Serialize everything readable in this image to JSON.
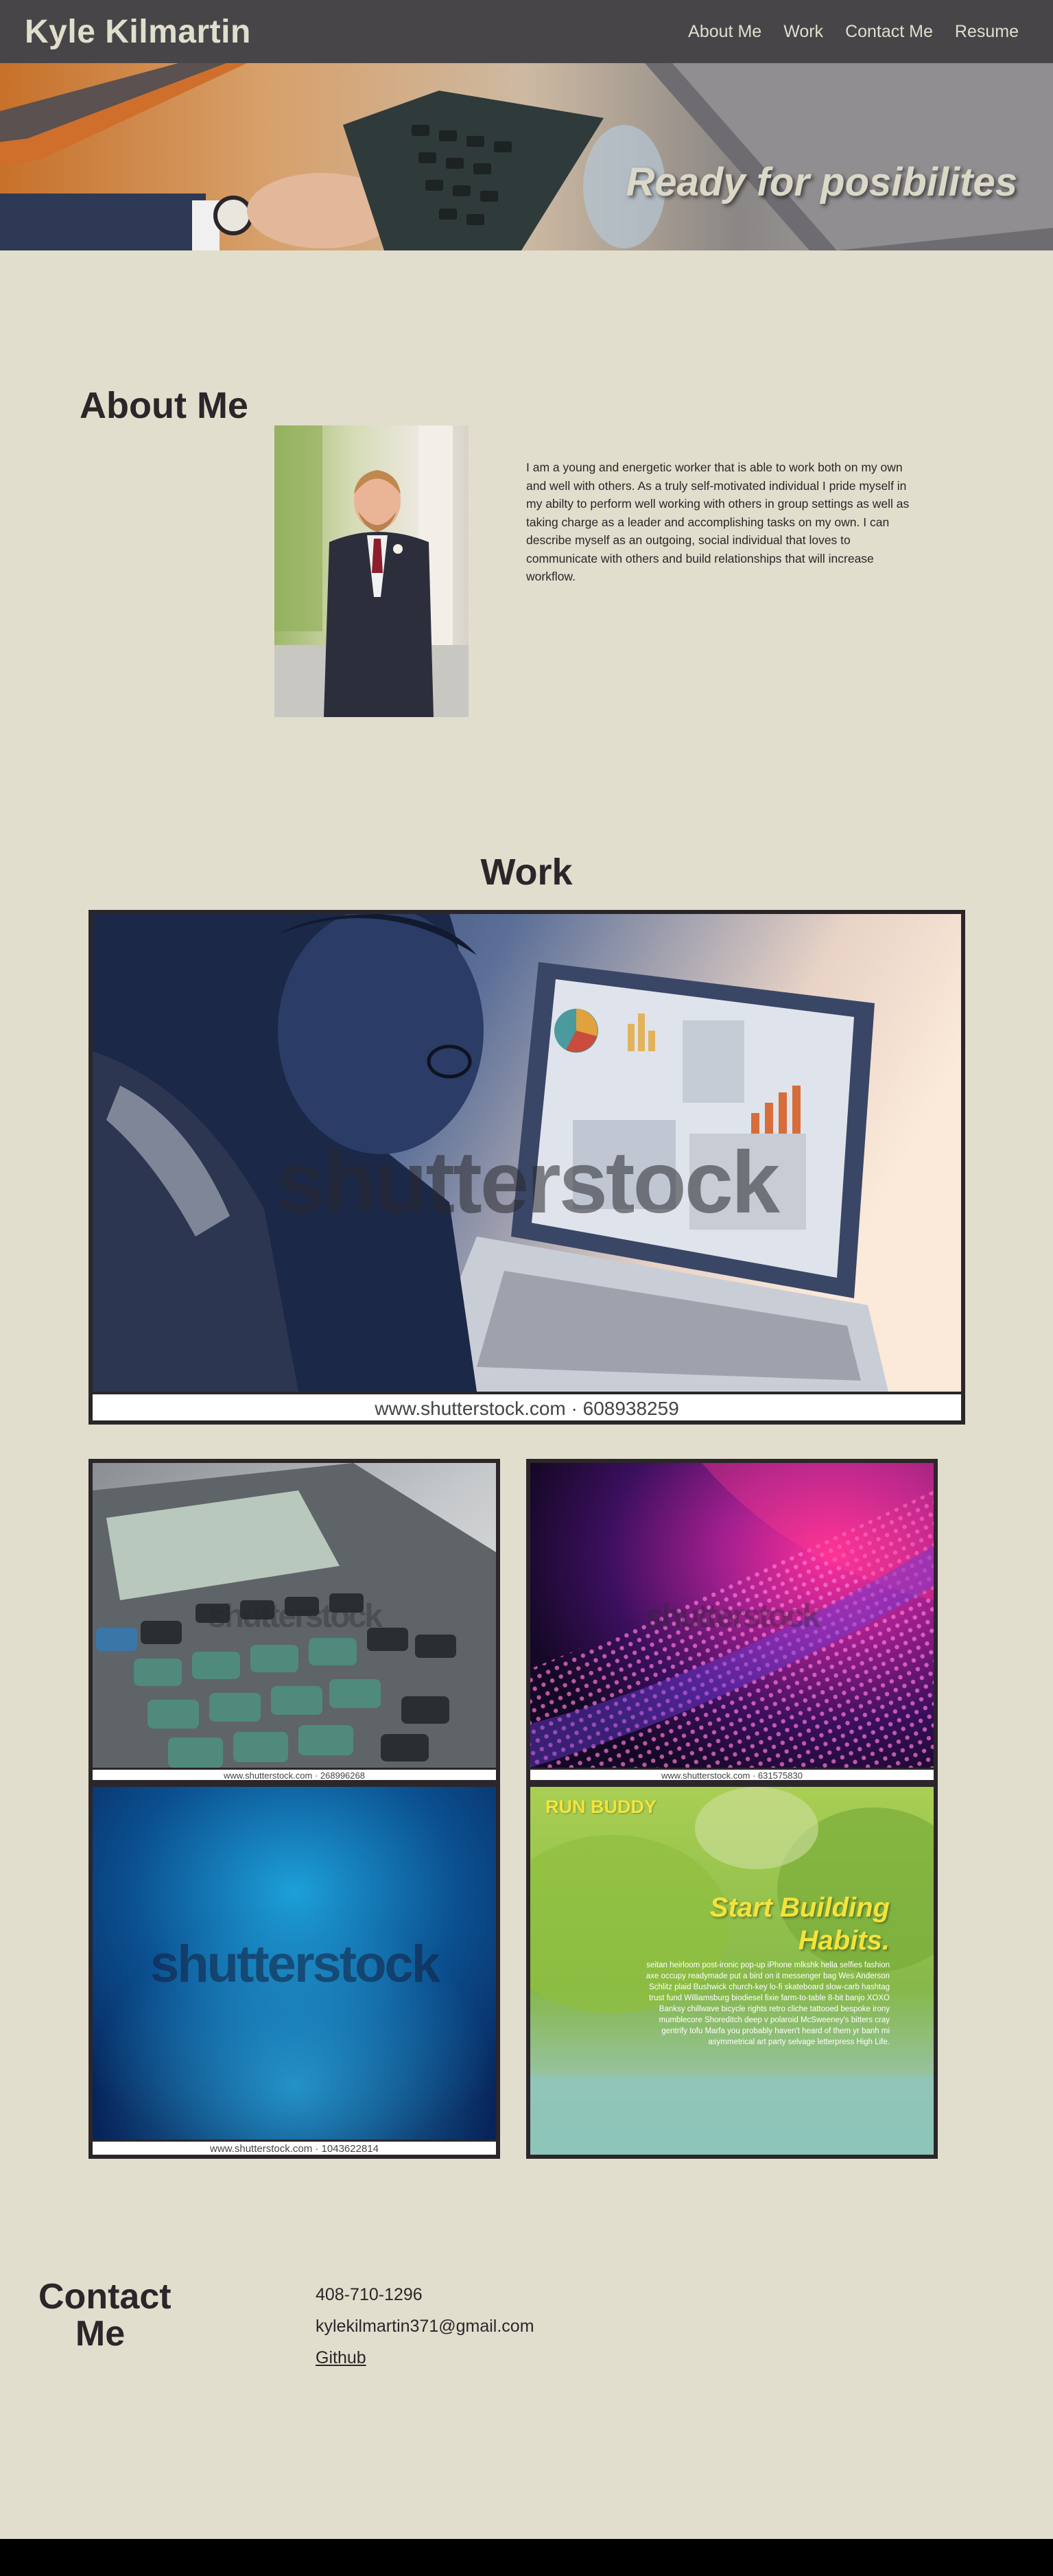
{
  "nav": {
    "brand": "Kyle Kilmartin",
    "links": [
      "About Me",
      "Work",
      "Contact Me",
      "Resume"
    ]
  },
  "hero": {
    "tagline": "Ready for posibilites"
  },
  "about": {
    "heading": "About Me",
    "body": "I am a young and energetic worker that is able to work both on my own and well with others. As a truly self-motivated individual I pride myself in my abilty to perform well working with others in group settings as well as taking charge as a leader and accomplishing tasks on my own. I can describe myself as an outgoing, social individual that loves to communicate with others and build relationships that will increase workflow."
  },
  "work": {
    "heading": "Work",
    "watermark": "shutterstock",
    "projects": [
      {
        "caption": "www.shutterstock.com · 608938259"
      },
      {
        "caption": "www.shutterstock.com · 268996268"
      },
      {
        "caption": "www.shutterstock.com · 631575830"
      },
      {
        "caption": "www.shutterstock.com · 1043622814"
      }
    ],
    "run_buddy": {
      "title": "RUN BUDDY",
      "headline_1": "Start Building",
      "headline_2": "Habits.",
      "body": "seitan heirloom post-ironic pop-up iPhone mlkshk hella selfies fashion axe occupy readymade put a bird on it messenger bag Wes Anderson Schlitz plaid Bushwick church-key lo-fi skateboard slow-carb hashtag trust fund Williamsburg biodiesel fixie farm-to-table 8-bit banjo XOXO Banksy chillwave bicycle rights retro cliche tattooed bespoke irony mumblecore Shoreditch deep v polaroid McSweeney's bitters cray gentrify tofu Marfa you probably haven't heard of them yr banh mi asymmetrical art party selvage letterpress High Life."
    }
  },
  "contact": {
    "heading": "Contact Me",
    "phone": "408-710-1296",
    "email": "kylekilmartin371@gmail.com",
    "github": "Github"
  },
  "colors": {
    "background": "#e1decd",
    "nav": "#484548",
    "text": "#2b2629",
    "footer": "#000000"
  }
}
